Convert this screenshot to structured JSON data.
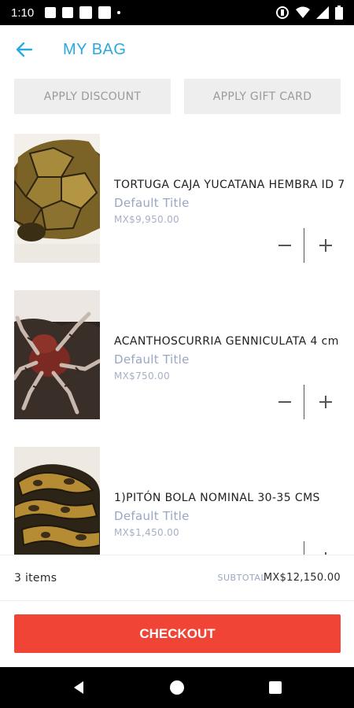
{
  "status_bar": {
    "time": "1:10"
  },
  "header": {
    "title": "MY BAG",
    "accent_color": "#29a9e0"
  },
  "actions": {
    "apply_discount": "APPLY DISCOUNT",
    "apply_gift_card": "APPLY GIFT CARD"
  },
  "cart": {
    "items": [
      {
        "name": "TORTUGA CAJA YUCATANA HEMBRA ID 7",
        "variant": "Default Title",
        "price": "MX$9,950.00",
        "image": "box-turtle-shell"
      },
      {
        "name": "ACANTHOSCURRIA GENNICULATA  4 cm",
        "variant": "Default Title",
        "price": "MX$750.00",
        "image": "tarantula"
      },
      {
        "name": "1)PITÓN BOLA NOMINAL 30-35 CMS",
        "variant": "Default Title",
        "price": "MX$1,450.00",
        "image": "ball-python"
      }
    ]
  },
  "summary": {
    "count_label": "3 items",
    "subtotal_label": "SUBTOTAL",
    "subtotal_value": "MX$12,150.00"
  },
  "checkout": {
    "label": "CHECKOUT",
    "color": "#f04436"
  }
}
